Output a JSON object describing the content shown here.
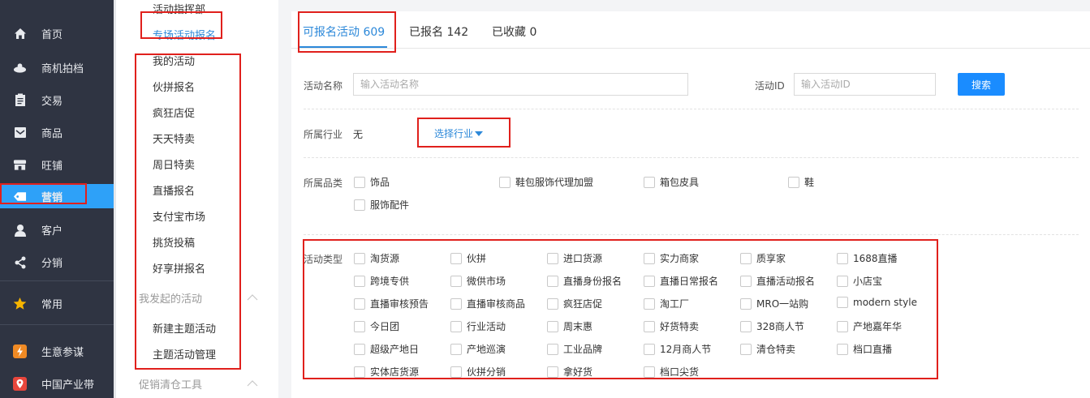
{
  "nav": {
    "items": [
      {
        "label": "首页",
        "icon": "home-icon"
      },
      {
        "label": "商机拍档",
        "icon": "handshake-icon"
      },
      {
        "label": "交易",
        "icon": "clipboard-icon"
      },
      {
        "label": "商品",
        "icon": "inbox-icon"
      },
      {
        "label": "旺铺",
        "icon": "shop-icon"
      },
      {
        "label": "营销",
        "icon": "tag-icon",
        "active": true
      },
      {
        "label": "客户",
        "icon": "user-icon"
      },
      {
        "label": "分销",
        "icon": "distribute-icon"
      },
      {
        "label": "常用",
        "icon": "star-icon"
      },
      {
        "label": "生意参谋",
        "icon": "lightning-icon"
      },
      {
        "label": "中国产业带",
        "icon": "location-icon"
      }
    ]
  },
  "submenu": {
    "top_items": [
      "活动指挥部",
      "专场活动报名"
    ],
    "items": [
      "我的活动",
      "伙拼报名",
      "疯狂店促",
      "天天特卖",
      "周日特卖",
      "直播报名",
      "支付宝市场",
      "挑货投稿",
      "好享拼报名"
    ],
    "group1": "我发起的活动",
    "group1_items": [
      "新建主题活动",
      "主题活动管理"
    ],
    "group2": "促销清仓工具"
  },
  "tabs": [
    {
      "label": "可报名活动 609"
    },
    {
      "label": "已报名 142"
    },
    {
      "label": "已收藏 0"
    }
  ],
  "form": {
    "activity_name_label": "活动名称",
    "activity_name_placeholder": "输入活动名称",
    "activity_id_label": "活动ID",
    "activity_id_placeholder": "输入活动ID",
    "search_label": "搜索",
    "industry_label": "所属行业",
    "industry_value": "无",
    "industry_select": "选择行业",
    "category_label": "所属品类",
    "categories": [
      "饰品",
      "鞋包服饰代理加盟",
      "箱包皮具",
      "鞋",
      "服饰配件"
    ],
    "type_label": "活动类型",
    "types": [
      [
        "淘货源",
        "伙拼",
        "进口货源",
        "实力商家",
        "质享家",
        "1688直播"
      ],
      [
        "跨境专供",
        "微供市场",
        "直播身份报名",
        "直播日常报名",
        "直播活动报名",
        "小店宝"
      ],
      [
        "直播审核预告",
        "直播审核商品",
        "疯狂店促",
        "淘工厂",
        "MRO一站购",
        "modern style"
      ],
      [
        "今日团",
        "行业活动",
        "周末惠",
        "好货特卖",
        "328商人节",
        "产地嘉年华"
      ],
      [
        "超级产地日",
        "产地巡演",
        "工业品牌",
        "12月商人节",
        "清仓特卖",
        "档口直播"
      ],
      [
        "实体店货源",
        "伙拼分销",
        "拿好货",
        "档口尖货"
      ]
    ]
  },
  "colors": {
    "nav_bg": "#2f3442",
    "active": "#2ea1f8",
    "link": "#2c88d9",
    "button": "#1a8cff",
    "annotation": "#e0201c"
  }
}
